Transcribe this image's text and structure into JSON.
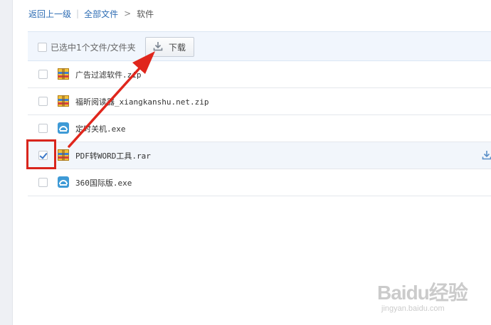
{
  "breadcrumb": {
    "back": "返回上一级",
    "all_files": "全部文件",
    "arrow": ">",
    "current": "软件"
  },
  "toolbar": {
    "selected_label": "已选中1个文件/文件夹",
    "download_label": "下载"
  },
  "files": [
    {
      "name": "广告过滤软件.zip",
      "type": "archive",
      "checked": false
    },
    {
      "name": "福昕阅读器_xiangkanshu.net.zip",
      "type": "archive",
      "checked": false
    },
    {
      "name": "定时关机.exe",
      "type": "exe",
      "checked": false
    },
    {
      "name": "PDF转WORD工具.rar",
      "type": "archive",
      "checked": true
    },
    {
      "name": "360国际版.exe",
      "type": "exe",
      "checked": false
    }
  ],
  "watermark": {
    "main": "Baidu经验",
    "sub": "jingyan.baidu.com"
  },
  "colors": {
    "link": "#2e6db4",
    "toolbar_bg": "#f1f6fd",
    "annotation_red": "#d9251c"
  }
}
